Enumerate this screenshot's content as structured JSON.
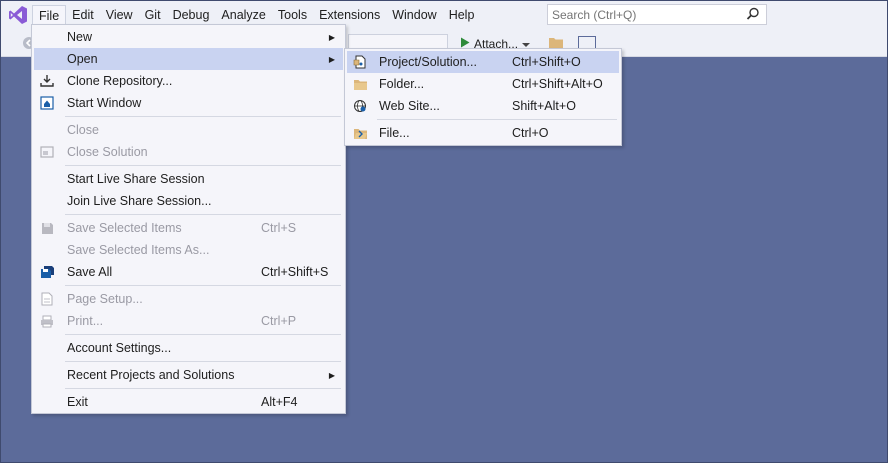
{
  "menubar": {
    "items": [
      "File",
      "Edit",
      "View",
      "Git",
      "Debug",
      "Analyze",
      "Tools",
      "Extensions",
      "Window",
      "Help"
    ],
    "search_placeholder": "Search (Ctrl+Q)"
  },
  "toolbar": {
    "attach_label": "Attach..."
  },
  "file_menu": {
    "items": [
      {
        "label": "New",
        "submenu": true
      },
      {
        "label": "Open",
        "submenu": true,
        "highlighted": true
      },
      {
        "label": "Clone Repository...",
        "icon": "clone-repo-icon"
      },
      {
        "label": "Start Window",
        "icon": "start-window-icon"
      },
      {
        "label": "Close",
        "disabled": true
      },
      {
        "label": "Close Solution",
        "disabled": true,
        "icon": "close-solution-icon"
      },
      {
        "label": "Start Live Share Session"
      },
      {
        "label": "Join Live Share Session..."
      },
      {
        "label": "Save Selected Items",
        "shortcut": "Ctrl+S",
        "disabled": true,
        "icon": "save-icon"
      },
      {
        "label": "Save Selected Items As...",
        "disabled": true
      },
      {
        "label": "Save All",
        "shortcut": "Ctrl+Shift+S",
        "icon": "save-all-icon"
      },
      {
        "label": "Page Setup...",
        "disabled": true,
        "icon": "page-setup-icon"
      },
      {
        "label": "Print...",
        "shortcut": "Ctrl+P",
        "disabled": true,
        "icon": "print-icon"
      },
      {
        "label": "Account Settings..."
      },
      {
        "label": "Recent Projects and Solutions",
        "submenu": true
      },
      {
        "label": "Exit",
        "shortcut": "Alt+F4"
      }
    ]
  },
  "open_submenu": {
    "items": [
      {
        "label": "Project/Solution...",
        "shortcut": "Ctrl+Shift+O",
        "icon": "project-solution-icon",
        "highlighted": true
      },
      {
        "label": "Folder...",
        "shortcut": "Ctrl+Shift+Alt+O",
        "icon": "folder-icon"
      },
      {
        "label": "Web Site...",
        "shortcut": "Shift+Alt+O",
        "icon": "web-site-icon"
      },
      {
        "label": "File...",
        "shortcut": "Ctrl+O",
        "icon": "file-icon"
      }
    ]
  },
  "colors": {
    "background": "#5c6b9a",
    "menu_bg": "#f5f5fa",
    "highlight": "#c9d3f1",
    "accent": "#68217a"
  }
}
